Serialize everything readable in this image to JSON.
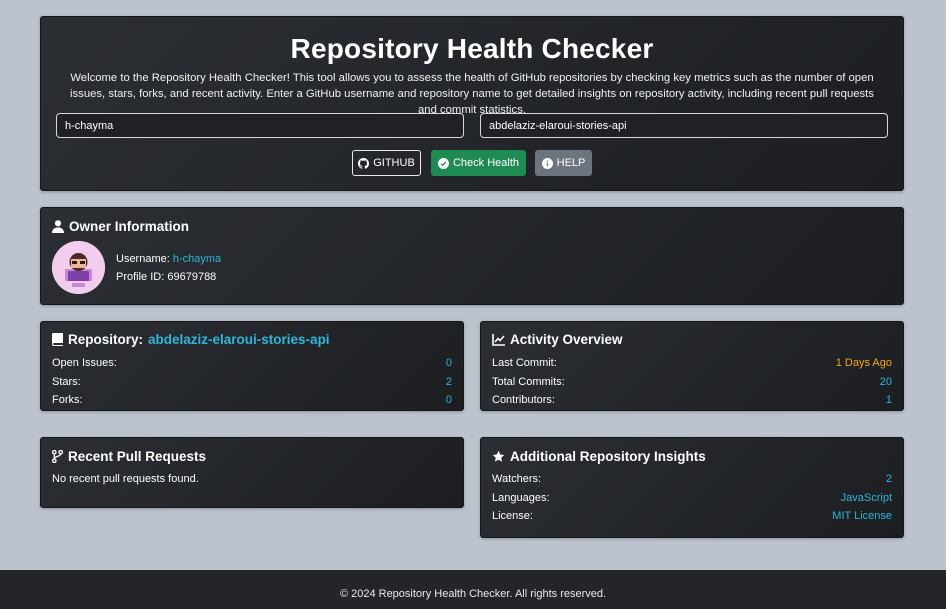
{
  "header": {
    "title": "Repository Health Checker",
    "description": "Welcome to the Repository Health Checker! This tool allows you to assess the health of GitHub repositories by checking key metrics such as the number of open issues, stars, forks, and recent activity. Enter a GitHub username and repository name to get detailed insights on repository activity, including recent pull requests and commit statistics.",
    "username_value": "h-chayma",
    "repo_value": "abdelaziz-elaroui-stories-api",
    "buttons": {
      "github": "GITHUB",
      "check": "Check Health",
      "help": "HELP"
    }
  },
  "owner": {
    "title": "Owner Information",
    "username_label": "Username:",
    "username": "h-chayma",
    "profile_id_label": "Profile ID:",
    "profile_id": "69679788"
  },
  "repository": {
    "title_prefix": "Repository:",
    "name": "abdelaziz-elaroui-stories-api",
    "rows": [
      {
        "label": "Open Issues:",
        "value": "0"
      },
      {
        "label": "Stars:",
        "value": "2"
      },
      {
        "label": "Forks:",
        "value": "0"
      }
    ]
  },
  "activity": {
    "title": "Activity Overview",
    "rows": [
      {
        "label": "Last Commit:",
        "value": "1 Days Ago"
      },
      {
        "label": "Total Commits:",
        "value": "20"
      },
      {
        "label": "Contributors:",
        "value": "1"
      }
    ]
  },
  "pull_requests": {
    "title": "Recent Pull Requests",
    "empty": "No recent pull requests found."
  },
  "insights": {
    "title": "Additional Repository Insights",
    "rows": [
      {
        "label": "Watchers:",
        "value": "2"
      },
      {
        "label": "Languages:",
        "value": "JavaScript"
      },
      {
        "label": "License:",
        "value": "MIT License"
      }
    ]
  },
  "footer": {
    "text": "© 2024 Repository Health Checker. All rights reserved."
  },
  "colors": {
    "accent": "#2fb6d8",
    "warning": "#f5a623",
    "success": "#1f8a51",
    "secondary": "#6c757d",
    "background": "#bcc3cd"
  }
}
